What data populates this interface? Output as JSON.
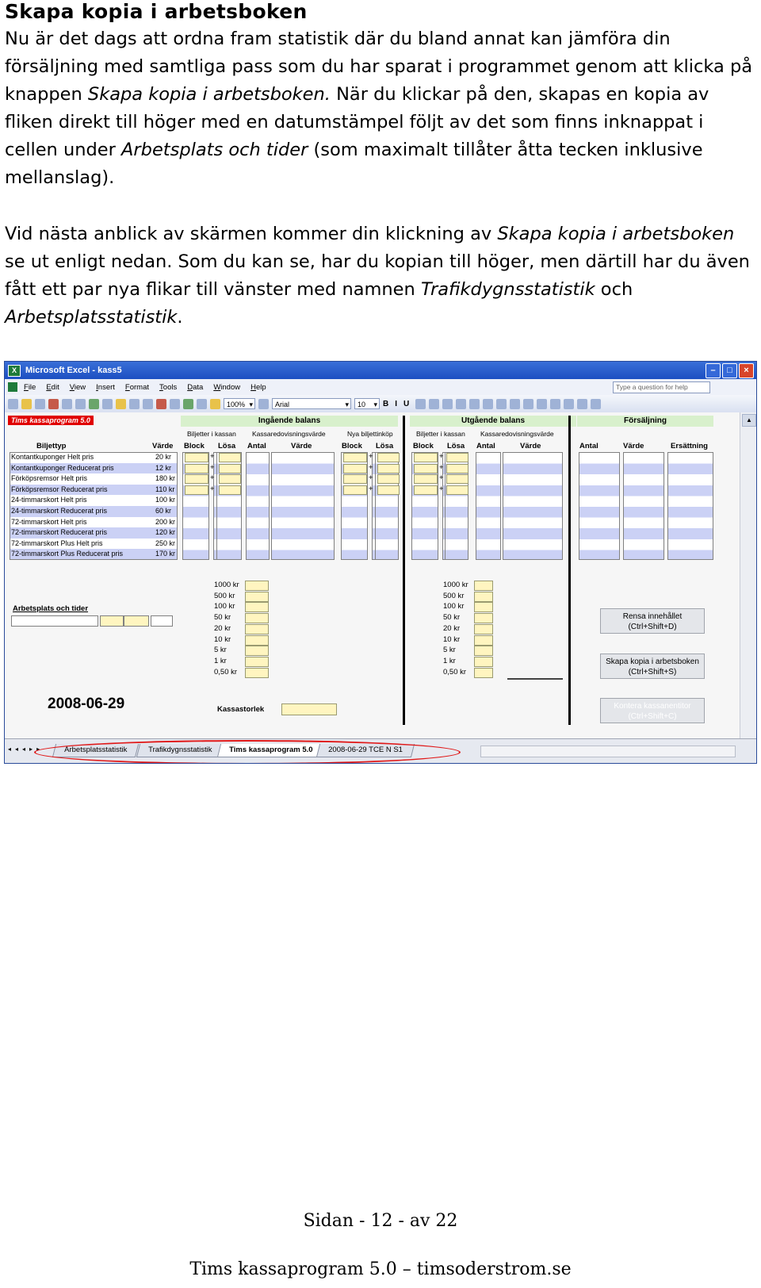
{
  "document": {
    "title": "Skapa kopia i arbetsboken",
    "p1": [
      {
        "t": "Nu är det dags att ordna fram statistik där du bland annat kan jämföra din försäljning med samtliga pass som du har sparat i programmet genom att klicka på knappen ",
        "i": false
      },
      {
        "t": "Skapa kopia i arbetsboken.",
        "i": true
      },
      {
        "t": " När du klickar på den, skapas en kopia av fliken direkt till höger med en datumstämpel följt av det som finns inknappat i cellen under ",
        "i": false
      },
      {
        "t": "Arbetsplats och tider",
        "i": true
      },
      {
        "t": " (som maximalt tillåter åtta tecken inklusive mellanslag).",
        "i": false
      }
    ],
    "p2": [
      {
        "t": "Vid nästa anblick av skärmen kommer din klickning av ",
        "i": false
      },
      {
        "t": "Skapa kopia i arbetsboken",
        "i": true
      },
      {
        "t": " se ut enligt nedan. Som du kan se, har du kopian till höger, men därtill har du även fått ett par nya flikar till vänster med namnen ",
        "i": false
      },
      {
        "t": "Trafikdygnsstatistik",
        "i": true
      },
      {
        "t": " och ",
        "i": false
      },
      {
        "t": "Arbetsplatsstatistik",
        "i": true
      },
      {
        "t": ".",
        "i": false
      }
    ]
  },
  "excel": {
    "window_title": "Microsoft Excel - kass5",
    "menu": [
      "File",
      "Edit",
      "View",
      "Insert",
      "Format",
      "Tools",
      "Data",
      "Window",
      "Help"
    ],
    "help_placeholder": "Type a question for help",
    "zoom": "100%",
    "font": "Arial",
    "font_size": "10",
    "sheet": {
      "red_label": "Tims kassaprogram 5.0",
      "ingaende": "Ingående balans",
      "utgaende": "Utgående balans",
      "forsaljning": "Försäljning",
      "biljetter_i_kassan": "Biljetter i kassan",
      "kassaredovisning": "Kassaredovisningsvärde",
      "nya_biljettinkop": "Nya biljettinköp",
      "biljettyp": "Biljettyp",
      "varde": "Värde",
      "block": "Block",
      "losa": "Lösa",
      "antal": "Antal",
      "ersattning": "Ersättning",
      "tickets": [
        {
          "name": "Kontantkuponger Helt pris",
          "value": "20 kr"
        },
        {
          "name": "Kontantkuponger Reducerat pris",
          "value": "12 kr"
        },
        {
          "name": "Förköpsremsor Helt pris",
          "value": "180 kr"
        },
        {
          "name": "Förköpsremsor Reducerat pris",
          "value": "110 kr"
        },
        {
          "name": "24-timmarskort Helt pris",
          "value": "100 kr"
        },
        {
          "name": "24-timmarskort Reducerat pris",
          "value": "60 kr"
        },
        {
          "name": "72-timmarskort Helt pris",
          "value": "200 kr"
        },
        {
          "name": "72-timmarskort Reducerat pris",
          "value": "120 kr"
        },
        {
          "name": "72-timmarskort Plus Helt pris",
          "value": "250 kr"
        },
        {
          "name": "72-timmarskort Plus Reducerat pris",
          "value": "170 kr"
        }
      ],
      "denominations": [
        "1000 kr",
        "500 kr",
        "100 kr",
        "50 kr",
        "20 kr",
        "10 kr",
        "5 kr",
        "1 kr",
        "0,50 kr"
      ],
      "arbetsplats": "Arbetsplats och tider",
      "date": "2008-06-29",
      "kassastorlek": "Kassastorlek",
      "btn_rensa": [
        "Rensa innehållet",
        "(Ctrl+Shift+D)"
      ],
      "btn_skapa": [
        "Skapa kopia i arbetsboken",
        "(Ctrl+Shift+S)"
      ],
      "btn_kontera": [
        "Kontera kassanentitor",
        "(Ctrl+Shift+C)"
      ]
    },
    "tabs": [
      "Arbetsplatsstatistik",
      "Trafikdygnsstatistik",
      "Tims kassaprogram 5.0",
      "2008-06-29 TCE N S1"
    ],
    "active_tab": "Tims kassaprogram 5.0"
  },
  "footer": {
    "page": "Sidan - 12 - av 22",
    "site": "Tims kassaprogram 5.0 – timsoderstrom.se"
  }
}
